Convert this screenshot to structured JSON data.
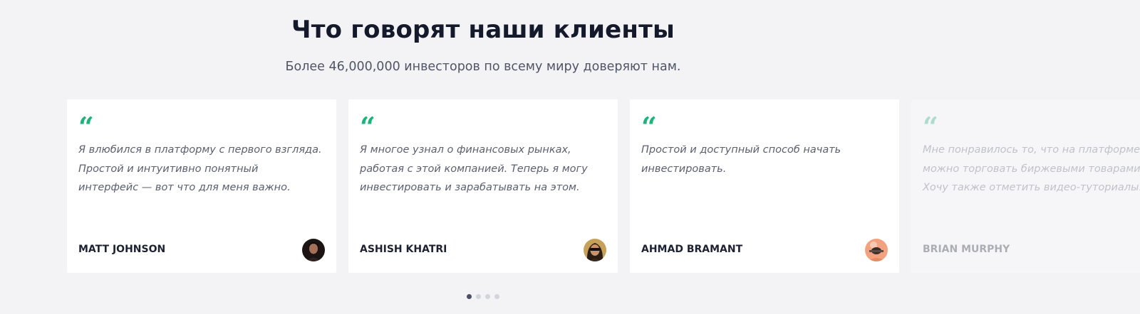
{
  "section": {
    "title": "Что говорят наши клиенты",
    "subtitle": "Более 46,000,000 инвесторов по всему миру доверяют нам."
  },
  "testimonials": [
    {
      "quote_icon": "quote-icon",
      "lines": [
        "Я влюбился в платформу с первого взгляда.",
        "Простой и интуитивно понятный",
        "интерфейс — вот что для меня важно."
      ],
      "author": "MATT JOHNSON",
      "avatar": "avatar-man-dark-hair"
    },
    {
      "quote_icon": "quote-icon",
      "lines": [
        "Я многое узнал о финансовых рынках,",
        "работая с этой компанией. Теперь я могу",
        "инвестировать и зарабатывать на этом."
      ],
      "author": "ASHISH KHATRI",
      "avatar": "avatar-person-sunglasses"
    },
    {
      "quote_icon": "quote-icon",
      "lines": [
        "Простой и доступный способ начать",
        "инвестировать."
      ],
      "author": "AHMAD BRAMANT",
      "avatar": "avatar-person-orange"
    },
    {
      "quote_icon": "quote-icon",
      "lines": [
        "Мне понравилось то, что на платформе",
        "можно торговать биржевыми товарами.",
        "Хочу также отметить видео-туториалы."
      ],
      "author": "BRIAN MURPHY",
      "avatar": ""
    }
  ],
  "pagination": {
    "count": 4,
    "active_index": 0
  },
  "colors": {
    "accent": "#1fb37c",
    "background": "#f3f3f5",
    "card": "#ffffff",
    "dot_active": "#4b5064",
    "dot_inactive": "#d3d5dc"
  }
}
